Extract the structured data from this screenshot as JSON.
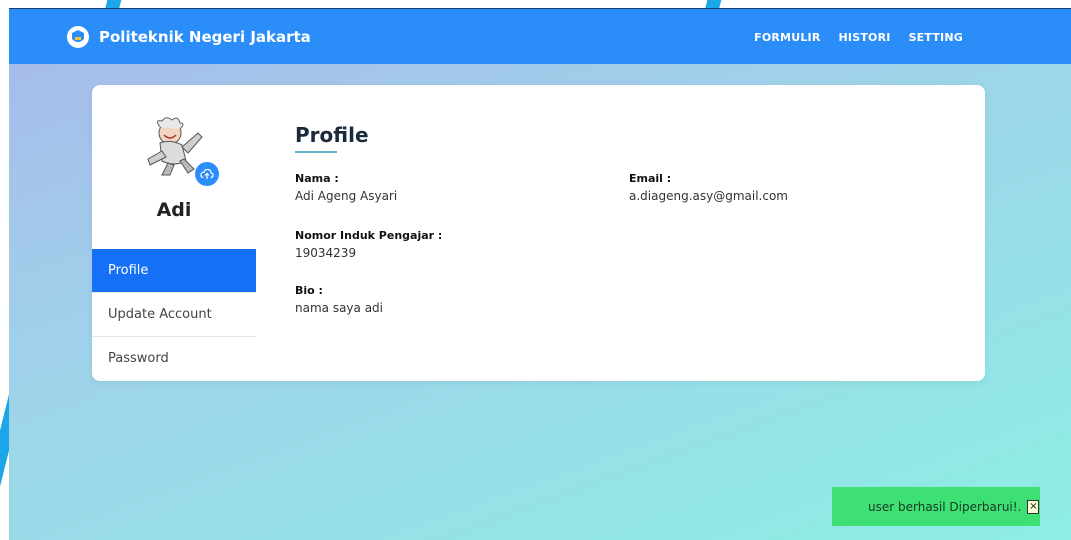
{
  "navbar": {
    "brand": "Politeknik Negeri Jakarta",
    "links": [
      "FORMULIR",
      "HISTORI",
      "SETTING"
    ]
  },
  "profile_sidebar": {
    "user_name": "Adi",
    "menu": [
      "Profile",
      "Update Account",
      "Password"
    ],
    "active_index": 0
  },
  "profile": {
    "title": "Profile",
    "fields": {
      "nama_label": "Nama :",
      "nama_value": "Adi Ageng Asyari",
      "email_label": "Email :",
      "email_value": "a.diageng.asy@gmail.com",
      "nip_label": "Nomor Induk Pengajar :",
      "nip_value": "19034239",
      "bio_label": "Bio :",
      "bio_value": "nama saya adi"
    }
  },
  "toast": {
    "message": "user berhasil Diperbarui!.",
    "close_label": "×"
  },
  "icons": {
    "brand_logo": "campus-logo-icon",
    "upload": "cloud-upload-icon",
    "close": "close-icon"
  },
  "colors": {
    "navbar": "#2b8df7",
    "active_menu": "#1570f5",
    "toast": "#3ee074"
  }
}
